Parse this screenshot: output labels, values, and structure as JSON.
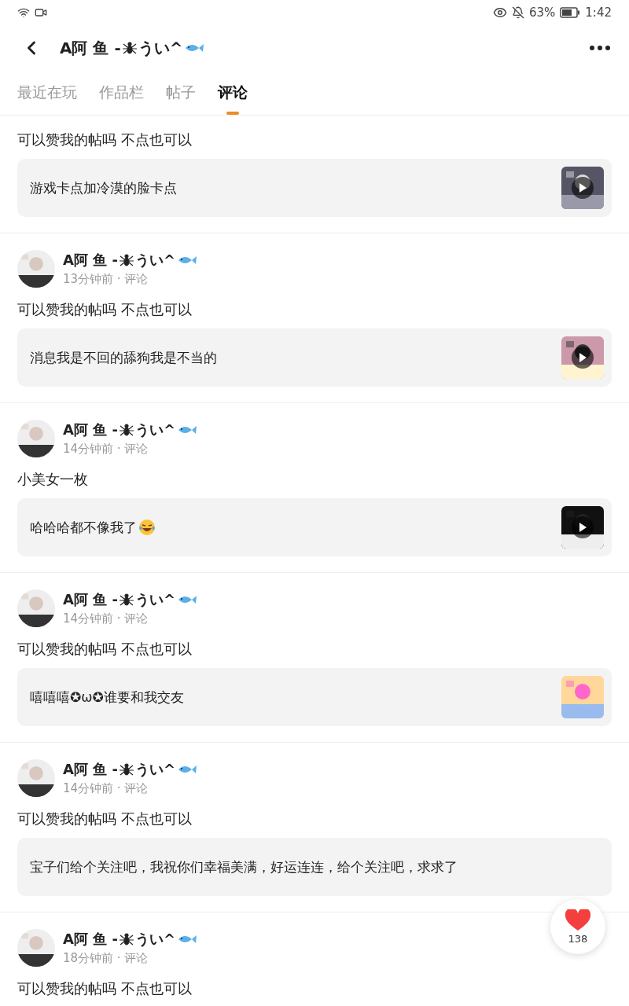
{
  "status_bar": {
    "battery": "63%",
    "time": "1:42"
  },
  "header": {
    "title_prefix": "A阿 鱼 -",
    "title_suffix": "うい^"
  },
  "tabs": [
    {
      "label": "最近在玩",
      "selected": false
    },
    {
      "label": "作品栏",
      "selected": false
    },
    {
      "label": "帖子",
      "selected": false
    },
    {
      "label": "评论",
      "selected": true
    }
  ],
  "posts": [
    {
      "text": "可以赞我的帖吗 不点也可以",
      "quote": "游戏卡点加冷漠的脸卡点",
      "thumbnail": true,
      "video": true
    },
    {
      "author": {
        "prefix": "A阿 鱼 -",
        "suffix": "うい^"
      },
      "meta": "13分钟前 · 评论",
      "text": "可以赞我的帖吗 不点也可以",
      "quote": "消息我是不回的舔狗我是不当的",
      "thumbnail": true,
      "video": true
    },
    {
      "author": {
        "prefix": "A阿 鱼 -",
        "suffix": "うい^"
      },
      "meta": "14分钟前 · 评论",
      "text": "小美女一枚",
      "quote": "哈哈哈都不像我了",
      "trailing_emoji": true,
      "thumbnail": true,
      "video": true
    },
    {
      "author": {
        "prefix": "A阿 鱼 -",
        "suffix": "うい^"
      },
      "meta": "14分钟前 · 评论",
      "text": "可以赞我的帖吗 不点也可以",
      "quote": "嘻嘻嘻✪ω✪谁要和我交友",
      "thumbnail": true,
      "video": false
    },
    {
      "author": {
        "prefix": "A阿 鱼 -",
        "suffix": "うい^"
      },
      "meta": "14分钟前 · 评论",
      "text": "可以赞我的帖吗 不点也可以",
      "quote": "宝子们给个关注吧，我祝你们幸福美满，好运连连，给个关注吧，求求了",
      "thumbnail": false
    },
    {
      "author": {
        "prefix": "A阿 鱼 -",
        "suffix": "うい^"
      },
      "meta": "18分钟前 · 评论",
      "text": "可以赞我的帖吗 不点也可以"
    }
  ],
  "like": {
    "count": "138"
  }
}
